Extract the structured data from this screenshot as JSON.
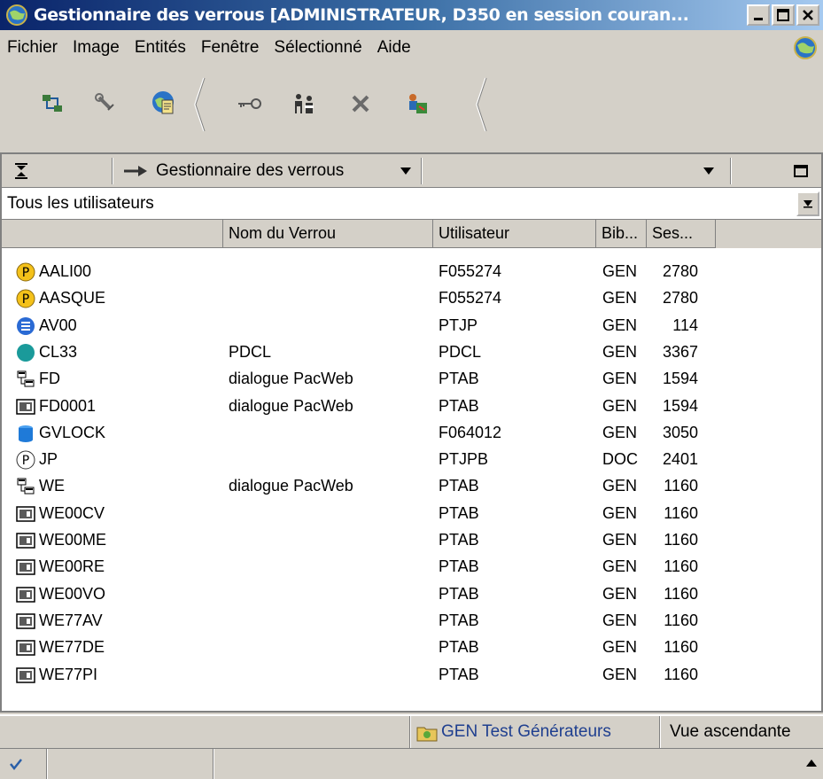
{
  "window": {
    "title": "Gestionnaire des verrous [ADMINISTRATEUR, D350 en session couran..."
  },
  "menu": [
    {
      "label": "Fichier"
    },
    {
      "label": "Image"
    },
    {
      "label": "Entités"
    },
    {
      "label": "Fenêtre"
    },
    {
      "label": "Sélectionné"
    },
    {
      "label": "Aide"
    }
  ],
  "toolbar": {
    "buttons": [
      "network-refresh-icon",
      "wrench-icon",
      "globe-document-icon",
      "key-icon",
      "people-icon",
      "delete-x-icon",
      "users-config-icon"
    ]
  },
  "pane": {
    "title": "Gestionnaire des verrous",
    "filter": "Tous les utilisateurs"
  },
  "columns": [
    "",
    "Nom du Verrou",
    "Utilisateur",
    "Bib...",
    "Ses..."
  ],
  "rows": [
    {
      "name": "AALI00",
      "lock": "",
      "user": "F055274",
      "lib": "GEN",
      "session": "2780",
      "icon": "p-yellow"
    },
    {
      "name": "AASQUE",
      "lock": "",
      "user": "F055274",
      "lib": "GEN",
      "session": "2780",
      "icon": "p-yellow"
    },
    {
      "name": "AV00",
      "lock": "",
      "user": "PTJP",
      "lib": "GEN",
      "session": "114",
      "icon": "list-blue"
    },
    {
      "name": "CL33",
      "lock": "PDCL",
      "user": "PDCL",
      "lib": "GEN",
      "session": "3367",
      "icon": "circle-teal"
    },
    {
      "name": "FD",
      "lock": "dialogue PacWeb",
      "user": "PTAB",
      "lib": "GEN",
      "session": "1594",
      "icon": "tree"
    },
    {
      "name": "FD0001",
      "lock": "dialogue PacWeb",
      "user": "PTAB",
      "lib": "GEN",
      "session": "1594",
      "icon": "screen"
    },
    {
      "name": "GVLOCK",
      "lock": "",
      "user": "F064012",
      "lib": "GEN",
      "session": "3050",
      "icon": "cylinder-blue"
    },
    {
      "name": "JP",
      "lock": "",
      "user": "PTJPB",
      "lib": "DOC",
      "session": "2401",
      "icon": "p-white"
    },
    {
      "name": "WE",
      "lock": "dialogue PacWeb",
      "user": "PTAB",
      "lib": "GEN",
      "session": "1160",
      "icon": "tree"
    },
    {
      "name": "WE00CV",
      "lock": "",
      "user": "PTAB",
      "lib": "GEN",
      "session": "1160",
      "icon": "screen"
    },
    {
      "name": "WE00ME",
      "lock": "",
      "user": "PTAB",
      "lib": "GEN",
      "session": "1160",
      "icon": "screen"
    },
    {
      "name": "WE00RE",
      "lock": "",
      "user": "PTAB",
      "lib": "GEN",
      "session": "1160",
      "icon": "screen"
    },
    {
      "name": "WE00VO",
      "lock": "",
      "user": "PTAB",
      "lib": "GEN",
      "session": "1160",
      "icon": "screen"
    },
    {
      "name": "WE77AV",
      "lock": "",
      "user": "PTAB",
      "lib": "GEN",
      "session": "1160",
      "icon": "screen"
    },
    {
      "name": "WE77DE",
      "lock": "",
      "user": "PTAB",
      "lib": "GEN",
      "session": "1160",
      "icon": "screen"
    },
    {
      "name": "WE77PI",
      "lock": "",
      "user": "PTAB",
      "lib": "GEN",
      "session": "1160",
      "icon": "screen"
    }
  ],
  "status": {
    "library": "GEN Test Générateurs",
    "view": "Vue ascendante"
  },
  "colors": {
    "accent": "#0a246a",
    "library_text": "#1f3f8f"
  }
}
